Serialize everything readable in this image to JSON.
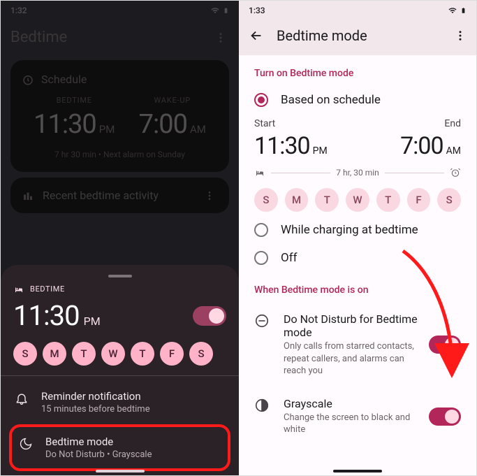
{
  "left": {
    "status_time": "1:32",
    "title": "Bedtime",
    "schedule_label": "Schedule",
    "bedtime_label": "BEDTIME",
    "wakeup_label": "WAKE-UP",
    "bedtime_time": "11:30",
    "bedtime_ampm": "PM",
    "wakeup_time": "7:00",
    "wakeup_ampm": "AM",
    "duration_note": "7 hr 30 min • Next alarm on Sunday",
    "activity_label": "Recent bedtime activity",
    "sheet": {
      "section_label": "BEDTIME",
      "time": "11:30",
      "ampm": "PM",
      "days": [
        "S",
        "M",
        "T",
        "W",
        "T",
        "F",
        "S"
      ],
      "reminder_title": "Reminder notification",
      "reminder_sub": "15 minutes before bedtime",
      "mode_title": "Bedtime mode",
      "mode_sub": "Do Not Disturb • Grayscale"
    }
  },
  "right": {
    "status_time": "1:33",
    "title": "Bedtime mode",
    "section_turn_on": "Turn on Bedtime mode",
    "opt_schedule": "Based on schedule",
    "start_label": "Start",
    "end_label": "End",
    "start_time": "11:30",
    "start_ampm": "PM",
    "end_time": "7:00",
    "end_ampm": "AM",
    "duration": "7 hr, 30 min",
    "days": [
      "S",
      "M",
      "T",
      "W",
      "T",
      "F",
      "S"
    ],
    "opt_charging": "While charging at bedtime",
    "opt_off": "Off",
    "section_when_on": "When Bedtime mode is on",
    "dnd_title": "Do Not Disturb for Bedtime mode",
    "dnd_sub": "Only calls from starred contacts, repeat callers, and alarms can reach you",
    "gray_title": "Grayscale",
    "gray_sub": "Change the screen to black and white"
  }
}
